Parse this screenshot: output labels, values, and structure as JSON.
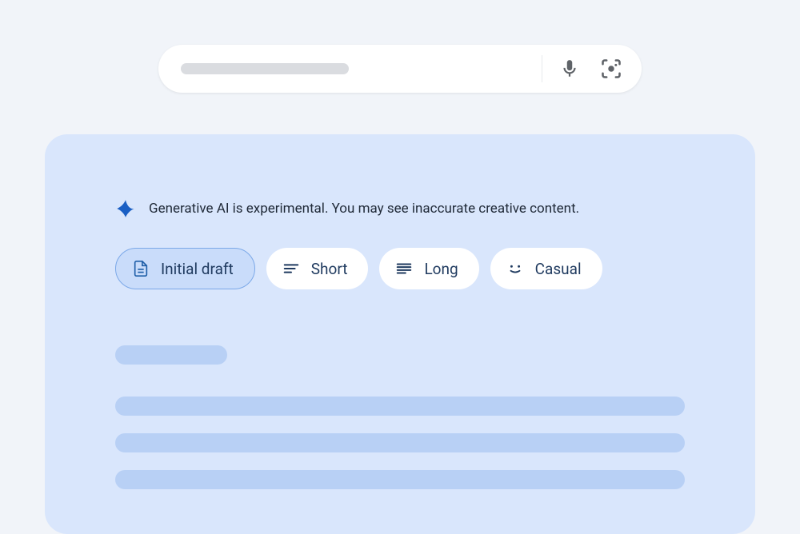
{
  "notice": {
    "text": "Generative AI is experimental. You may see inaccurate creative content."
  },
  "chips": {
    "initial_draft": "Initial draft",
    "short": "Short",
    "long": "Long",
    "casual": "Casual"
  }
}
